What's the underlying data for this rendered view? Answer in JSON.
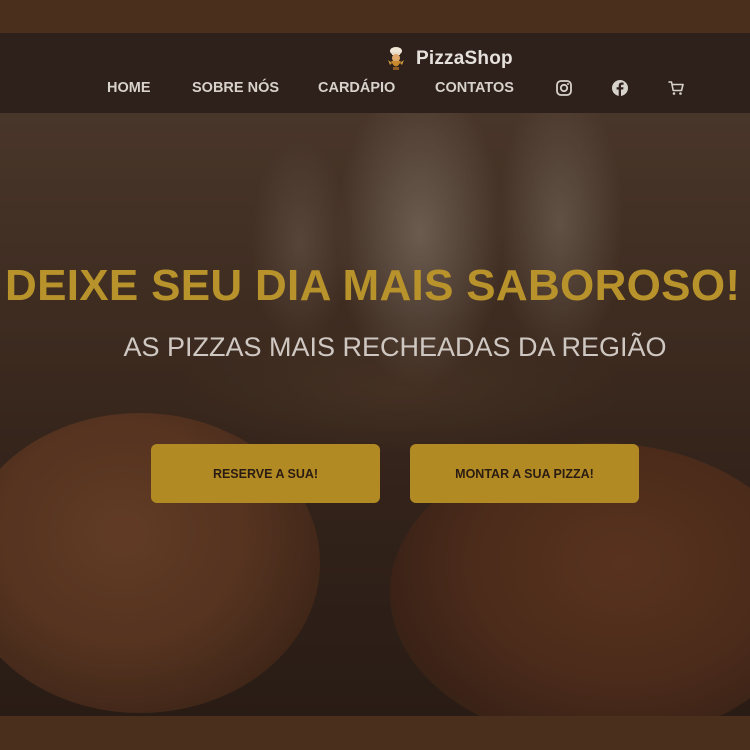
{
  "brand": {
    "name": "PizzaShop",
    "logo_icon": "chef-logo-icon"
  },
  "nav": {
    "items": [
      {
        "label": "HOME"
      },
      {
        "label": "SOBRE NÓS"
      },
      {
        "label": "CARDÁPIO"
      },
      {
        "label": "CONTATOS"
      }
    ],
    "icons": [
      "instagram-icon",
      "facebook-icon",
      "cart-icon"
    ]
  },
  "hero": {
    "title": "DEIXE SEU DIA MAIS SABOROSO!",
    "subtitle": "AS PIZZAS MAIS RECHEADAS DA REGIÃO",
    "primary_button": "RESERVE A SUA!",
    "secondary_button": "MONTAR A SUA PIZZA!"
  },
  "colors": {
    "header_bg": "#2e211b",
    "page_bg": "#4a2f1d",
    "accent_gold": "#b28a24",
    "title_gold": "#b8922a",
    "nav_text": "#d8d2cc"
  }
}
